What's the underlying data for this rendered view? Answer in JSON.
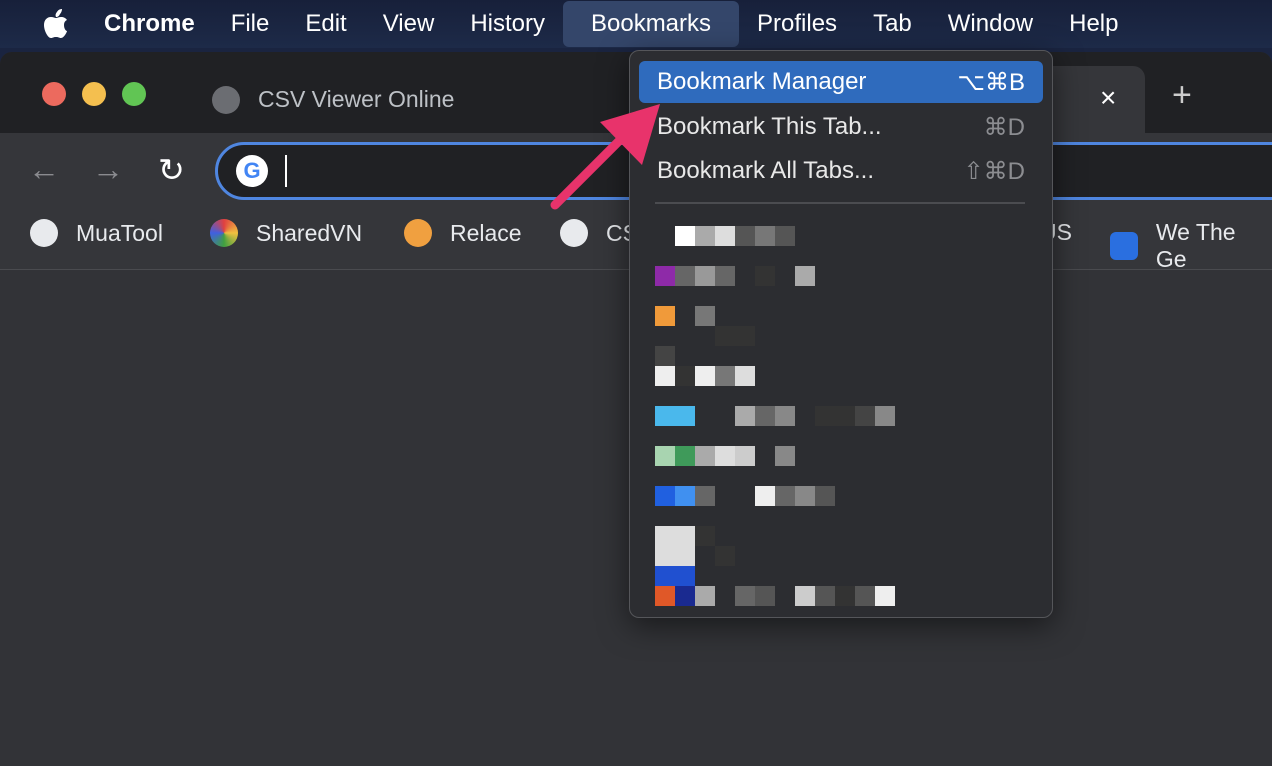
{
  "menubar": {
    "items": [
      "Chrome",
      "File",
      "Edit",
      "View",
      "History",
      "Bookmarks",
      "Profiles",
      "Tab",
      "Window",
      "Help"
    ],
    "active": "Bookmarks"
  },
  "tab": {
    "title": "CSV Viewer Online",
    "close": "×",
    "new_tab": "+"
  },
  "toolbar": {
    "back": "←",
    "forward": "→",
    "reload": "↻",
    "omnibox_value": ""
  },
  "bookmarks_bar": [
    {
      "label": "MuaTool",
      "icon": "globe-icon",
      "color": "#e8eaed"
    },
    {
      "label": "SharedVN",
      "icon": "sharedvn-icon",
      "color": "#7a9a4a"
    },
    {
      "label": "Relace",
      "icon": "relace-icon",
      "color": "#f0a040"
    },
    {
      "label": "CS",
      "icon": "globe-icon",
      "color": "#e8eaed"
    },
    {
      "label": "US",
      "icon": "",
      "color": ""
    },
    {
      "label": "We The Ge",
      "icon": "wtg-icon",
      "color": "#2a6fe0"
    }
  ],
  "bookmarks_menu": {
    "items": [
      {
        "label": "Bookmark Manager",
        "shortcut": "⌥⌘B",
        "highlighted": true
      },
      {
        "label": "Bookmark This Tab...",
        "shortcut": "⌘D"
      },
      {
        "label": "Bookmark All Tabs...",
        "shortcut": "⇧⌘D"
      }
    ]
  },
  "colors": {
    "accent": "#2f6bbd",
    "arrow": "#e8336b"
  }
}
